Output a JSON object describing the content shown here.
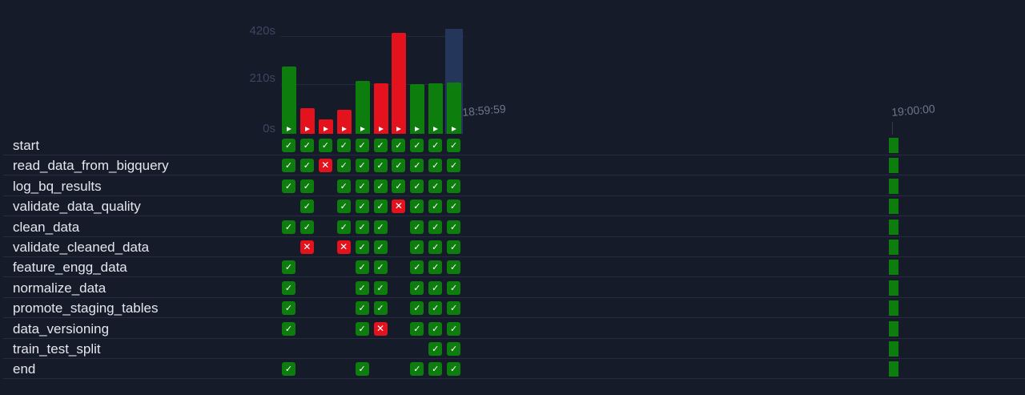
{
  "duration_chart": {
    "y_labels": [
      "420s",
      "210s",
      "0s"
    ],
    "max_seconds": 420,
    "runs": [
      {
        "duration_s": 295,
        "state": "success"
      },
      {
        "duration_s": 112,
        "state": "failed"
      },
      {
        "duration_s": 63,
        "state": "failed"
      },
      {
        "duration_s": 105,
        "state": "failed"
      },
      {
        "duration_s": 230,
        "state": "success"
      },
      {
        "duration_s": 220,
        "state": "failed"
      },
      {
        "duration_s": 440,
        "state": "failed"
      },
      {
        "duration_s": 217,
        "state": "success"
      },
      {
        "duration_s": 222,
        "state": "success"
      },
      {
        "duration_s": 225,
        "state": "success"
      }
    ],
    "selected_run": 9
  },
  "timeline": {
    "start_label": "18:59:59",
    "end_label": "19:00:00"
  },
  "colors": {
    "success": "#0d7d0d",
    "failed": "#e3121c",
    "upstream_failed": "#e4531c",
    "selected": "#25365b"
  },
  "tasks": [
    {
      "name": "start",
      "states": [
        "success",
        "success",
        "success",
        "success",
        "success",
        "success",
        "success",
        "success",
        "success",
        "success"
      ]
    },
    {
      "name": "read_data_from_bigquery",
      "states": [
        "success",
        "success",
        "failed",
        "success",
        "success",
        "success",
        "success",
        "success",
        "success",
        "success"
      ]
    },
    {
      "name": "log_bq_results",
      "states": [
        "success",
        "success",
        "upstream_failed",
        "success",
        "success",
        "success",
        "success",
        "success",
        "success",
        "success"
      ]
    },
    {
      "name": "validate_data_quality",
      "states": [
        null,
        "success",
        "upstream_failed",
        "success",
        "success",
        "success",
        "failed",
        "success",
        "success",
        "success"
      ]
    },
    {
      "name": "clean_data",
      "states": [
        "success",
        "success",
        "upstream_failed",
        "success",
        "success",
        "success",
        "upstream_failed",
        "success",
        "success",
        "success"
      ]
    },
    {
      "name": "validate_cleaned_data",
      "states": [
        null,
        "failed",
        "upstream_failed",
        "failed",
        "success",
        "success",
        "upstream_failed",
        "success",
        "success",
        "success"
      ]
    },
    {
      "name": "feature_engg_data",
      "states": [
        "success",
        "upstream_failed",
        "upstream_failed",
        "upstream_failed",
        "success",
        "success",
        "upstream_failed",
        "success",
        "success",
        "success"
      ]
    },
    {
      "name": "normalize_data",
      "states": [
        "success",
        "upstream_failed",
        "upstream_failed",
        "upstream_failed",
        "success",
        "success",
        "upstream_failed",
        "success",
        "success",
        "success"
      ]
    },
    {
      "name": "promote_staging_tables",
      "states": [
        "success",
        "upstream_failed",
        "upstream_failed",
        "upstream_failed",
        "success",
        "success",
        "upstream_failed",
        "success",
        "success",
        "success"
      ]
    },
    {
      "name": "data_versioning",
      "states": [
        "success",
        "upstream_failed",
        "upstream_failed",
        "upstream_failed",
        "success",
        "failed",
        "upstream_failed",
        "success",
        "success",
        "success"
      ]
    },
    {
      "name": "train_test_split",
      "states": [
        null,
        null,
        null,
        null,
        null,
        null,
        null,
        null,
        "success",
        "success"
      ]
    },
    {
      "name": "end",
      "states": [
        "success",
        "upstream_failed",
        "upstream_failed",
        "upstream_failed",
        "success",
        "upstream_failed",
        "upstream_failed",
        "success",
        "success",
        "success"
      ]
    }
  ]
}
